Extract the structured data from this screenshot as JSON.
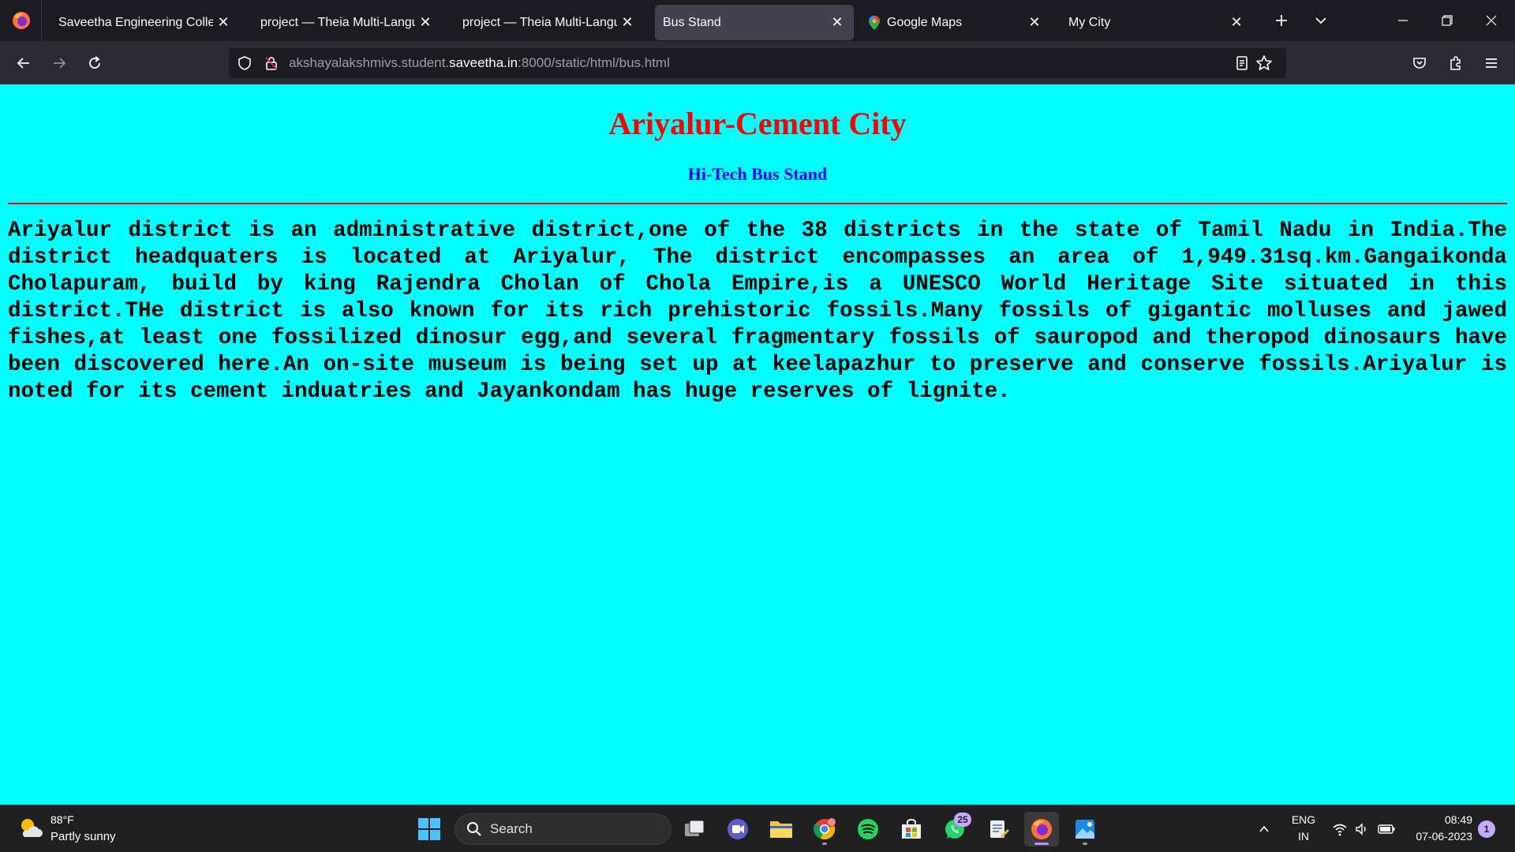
{
  "browser": {
    "tabs": [
      {
        "label": "Saveetha Engineering College",
        "active": false,
        "icon": ""
      },
      {
        "label": "project — Theia Multi-Language",
        "active": false,
        "icon": ""
      },
      {
        "label": "project — Theia Multi-Language",
        "active": false,
        "icon": ""
      },
      {
        "label": "Bus Stand",
        "active": true,
        "icon": ""
      },
      {
        "label": "Google Maps",
        "active": false,
        "icon": "maps-pin-icon"
      },
      {
        "label": "My City",
        "active": false,
        "icon": ""
      }
    ],
    "url": {
      "prefix": "akshayalakshmivs.student.",
      "host": "saveetha.in",
      "suffix": ":8000/static/html/bus.html"
    }
  },
  "page": {
    "title": "Ariyalur-Cement City",
    "subtitle": "Hi-Tech Bus Stand",
    "body": "Ariyalur district is an administrative district,one of the 38 districts in the state of Tamil Nadu in India.The district headquaters is located at Ariyalur, The district encompasses an area of 1,949.31sq.km.Gangaikonda Cholapuram, build by king Rajendra Cholan of Chola Empire,is a UNESCO World Heritage Site situated in this district.THe district is also known for its rich prehistoric fossils.Many fossils of gigantic molluses and jawed fishes,at least one fossilized dinosur egg,and several fragmentary fossils of sauropod and theropod dinosaurs have been discovered here.An on-site museum is being set up at keelapazhur to preserve and conserve fossils.Ariyalur is noted for its cement induatries and Jayankondam has huge reserves of lignite.",
    "colors": {
      "background": "#00ffff",
      "title": "#ff0000",
      "subtitle": "#0000ff",
      "rule": "#ff0000"
    }
  },
  "taskbar": {
    "weather": {
      "temp": "88°F",
      "desc": "Partly sunny"
    },
    "search_label": "Search",
    "whatsapp_badge": "25",
    "language": {
      "line1": "ENG",
      "line2": "IN"
    },
    "clock": {
      "time": "08:49",
      "date": "07-06-2023"
    },
    "notifications": "1"
  }
}
